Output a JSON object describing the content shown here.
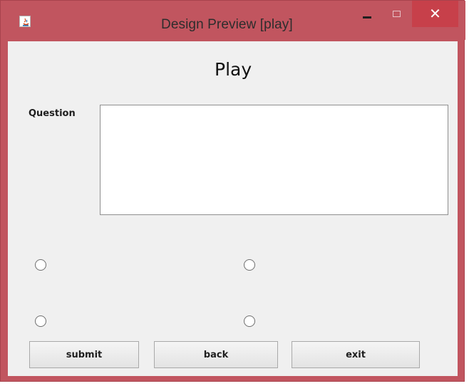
{
  "window": {
    "title": "Design Preview [play]",
    "controls": {
      "minimize": "–",
      "close": "✕"
    }
  },
  "main": {
    "title": "Play",
    "question_label": "Question",
    "question_value": ""
  },
  "buttons": {
    "submit": "submit",
    "back": "back",
    "exit": "exit"
  },
  "colors": {
    "title_bar": "#c1555f",
    "close_button": "#c7404a",
    "client_background": "#f0f0f0"
  },
  "icons": {
    "app": "java-icon",
    "minimize": "minimize-icon",
    "maximize": "maximize-icon",
    "close": "close-icon"
  }
}
